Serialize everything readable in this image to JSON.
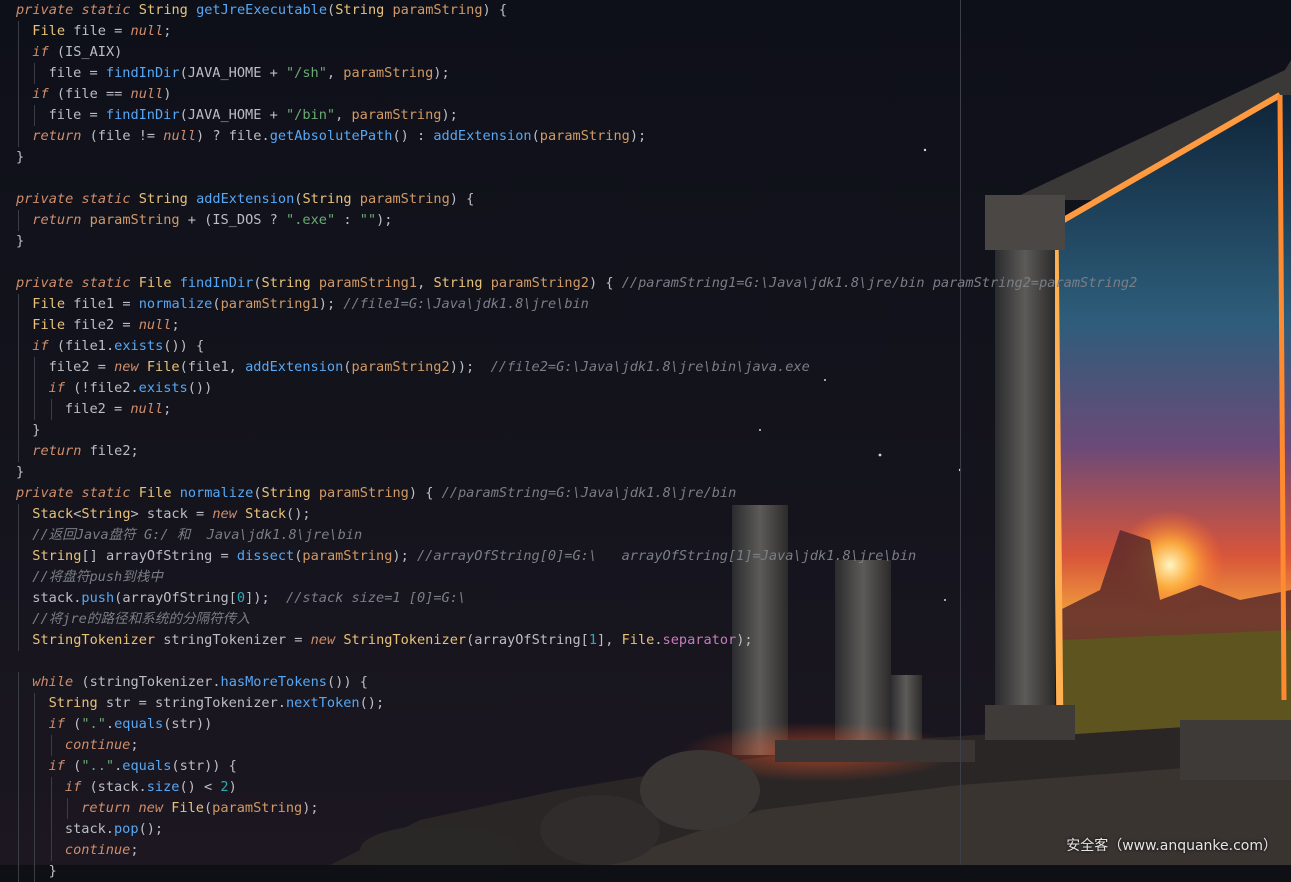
{
  "editor": {
    "colors": {
      "keyword": "#cf8e6d",
      "type": "#e8c27b",
      "method": "#56a8f5",
      "param": "#d19a66",
      "string": "#6aab73",
      "number": "#2aacb8",
      "comment": "#7a7e85",
      "const": "#c77dbb",
      "plain": "#bcbec4"
    },
    "lines": [
      {
        "indent": 0,
        "tokens": [
          [
            "private static ",
            "keyword"
          ],
          [
            "String ",
            "type"
          ],
          [
            "getJreExecutable",
            "method"
          ],
          [
            "(",
            "plain"
          ],
          [
            "String ",
            "type"
          ],
          [
            "paramString",
            "param"
          ],
          [
            ") {",
            "plain"
          ]
        ]
      },
      {
        "indent": 1,
        "tokens": [
          [
            "File",
            "type"
          ],
          [
            " file = ",
            "plain"
          ],
          [
            "null",
            "keyword"
          ],
          [
            ";",
            "plain"
          ]
        ]
      },
      {
        "indent": 1,
        "tokens": [
          [
            "if ",
            "keyword"
          ],
          [
            "(IS_AIX)",
            "plain"
          ]
        ]
      },
      {
        "indent": 2,
        "tokens": [
          [
            "file = ",
            "plain"
          ],
          [
            "findInDir",
            "method"
          ],
          [
            "(JAVA_HOME + ",
            "plain"
          ],
          [
            "\"/sh\"",
            "string"
          ],
          [
            ", ",
            "plain"
          ],
          [
            "paramString",
            "param"
          ],
          [
            ");",
            "plain"
          ]
        ]
      },
      {
        "indent": 1,
        "tokens": [
          [
            "if ",
            "keyword"
          ],
          [
            "(file == ",
            "plain"
          ],
          [
            "null",
            "keyword"
          ],
          [
            ")",
            "plain"
          ]
        ]
      },
      {
        "indent": 2,
        "tokens": [
          [
            "file = ",
            "plain"
          ],
          [
            "findInDir",
            "method"
          ],
          [
            "(JAVA_HOME + ",
            "plain"
          ],
          [
            "\"/bin\"",
            "string"
          ],
          [
            ", ",
            "plain"
          ],
          [
            "paramString",
            "param"
          ],
          [
            ");",
            "plain"
          ]
        ]
      },
      {
        "indent": 1,
        "tokens": [
          [
            "return ",
            "keyword"
          ],
          [
            "(file != ",
            "plain"
          ],
          [
            "null",
            "keyword"
          ],
          [
            ") ? file.",
            "plain"
          ],
          [
            "getAbsolutePath",
            "method"
          ],
          [
            "() : ",
            "plain"
          ],
          [
            "addExtension",
            "method"
          ],
          [
            "(",
            "plain"
          ],
          [
            "paramString",
            "param"
          ],
          [
            ");",
            "plain"
          ]
        ]
      },
      {
        "indent": 0,
        "tokens": [
          [
            "}",
            "plain"
          ]
        ]
      },
      {
        "indent": 0,
        "tokens": []
      },
      {
        "indent": 0,
        "tokens": [
          [
            "private static ",
            "keyword"
          ],
          [
            "String ",
            "type"
          ],
          [
            "addExtension",
            "method"
          ],
          [
            "(",
            "plain"
          ],
          [
            "String ",
            "type"
          ],
          [
            "paramString",
            "param"
          ],
          [
            ") {",
            "plain"
          ]
        ]
      },
      {
        "indent": 1,
        "tokens": [
          [
            "return ",
            "keyword"
          ],
          [
            "paramString",
            "param"
          ],
          [
            " + (IS_DOS ? ",
            "plain"
          ],
          [
            "\".exe\"",
            "string"
          ],
          [
            " : ",
            "plain"
          ],
          [
            "\"\"",
            "string"
          ],
          [
            ");",
            "plain"
          ]
        ]
      },
      {
        "indent": 0,
        "tokens": [
          [
            "}",
            "plain"
          ]
        ]
      },
      {
        "indent": 0,
        "tokens": []
      },
      {
        "indent": 0,
        "tokens": [
          [
            "private static ",
            "keyword"
          ],
          [
            "File ",
            "type"
          ],
          [
            "findInDir",
            "method"
          ],
          [
            "(",
            "plain"
          ],
          [
            "String ",
            "type"
          ],
          [
            "paramString1",
            "param"
          ],
          [
            ", ",
            "plain"
          ],
          [
            "String ",
            "type"
          ],
          [
            "paramString2",
            "param"
          ],
          [
            ") { ",
            "plain"
          ],
          [
            "//paramString1=G:\\Java\\jdk1.8\\jre/bin paramString2=paramString2",
            "comment"
          ]
        ]
      },
      {
        "indent": 1,
        "tokens": [
          [
            "File ",
            "type"
          ],
          [
            "file1 = ",
            "plain"
          ],
          [
            "normalize",
            "method"
          ],
          [
            "(",
            "plain"
          ],
          [
            "paramString1",
            "param"
          ],
          [
            "); ",
            "plain"
          ],
          [
            "//file1=G:\\Java\\jdk1.8\\jre\\bin",
            "comment"
          ]
        ]
      },
      {
        "indent": 1,
        "tokens": [
          [
            "File ",
            "type"
          ],
          [
            "file2 = ",
            "plain"
          ],
          [
            "null",
            "keyword"
          ],
          [
            ";",
            "plain"
          ]
        ]
      },
      {
        "indent": 1,
        "tokens": [
          [
            "if ",
            "keyword"
          ],
          [
            "(file1.",
            "plain"
          ],
          [
            "exists",
            "method"
          ],
          [
            "()) {",
            "plain"
          ]
        ]
      },
      {
        "indent": 2,
        "tokens": [
          [
            "file2 = ",
            "plain"
          ],
          [
            "new ",
            "keyword"
          ],
          [
            "File",
            "type"
          ],
          [
            "(file1, ",
            "plain"
          ],
          [
            "addExtension",
            "method"
          ],
          [
            "(",
            "plain"
          ],
          [
            "paramString2",
            "param"
          ],
          [
            "));  ",
            "plain"
          ],
          [
            "//file2=G:\\Java\\jdk1.8\\jre\\bin\\java.exe",
            "comment"
          ]
        ]
      },
      {
        "indent": 2,
        "tokens": [
          [
            "if ",
            "keyword"
          ],
          [
            "(!file2.",
            "plain"
          ],
          [
            "exists",
            "method"
          ],
          [
            "())",
            "plain"
          ]
        ]
      },
      {
        "indent": 3,
        "tokens": [
          [
            "file2 = ",
            "plain"
          ],
          [
            "null",
            "keyword"
          ],
          [
            ";",
            "plain"
          ]
        ]
      },
      {
        "indent": 1,
        "tokens": [
          [
            "}",
            "plain"
          ]
        ]
      },
      {
        "indent": 1,
        "tokens": [
          [
            "return ",
            "keyword"
          ],
          [
            "file2;",
            "plain"
          ]
        ]
      },
      {
        "indent": 0,
        "tokens": [
          [
            "}",
            "plain"
          ]
        ]
      },
      {
        "indent": 0,
        "tokens": [
          [
            "private static ",
            "keyword"
          ],
          [
            "File ",
            "type"
          ],
          [
            "normalize",
            "method"
          ],
          [
            "(",
            "plain"
          ],
          [
            "String ",
            "type"
          ],
          [
            "paramString",
            "param"
          ],
          [
            ") { ",
            "plain"
          ],
          [
            "//paramString=G:\\Java\\jdk1.8\\jre/bin",
            "comment"
          ]
        ]
      },
      {
        "indent": 1,
        "tokens": [
          [
            "Stack",
            "type"
          ],
          [
            "<",
            "plain"
          ],
          [
            "String",
            "type"
          ],
          [
            "> stack = ",
            "plain"
          ],
          [
            "new ",
            "keyword"
          ],
          [
            "Stack",
            "type"
          ],
          [
            "();",
            "plain"
          ]
        ]
      },
      {
        "indent": 1,
        "tokens": [
          [
            "//返回Java盘符 G:/ 和  Java\\jdk1.8\\jre\\bin",
            "comment"
          ]
        ]
      },
      {
        "indent": 1,
        "tokens": [
          [
            "String",
            "type"
          ],
          [
            "[] arrayOfString = ",
            "plain"
          ],
          [
            "dissect",
            "method"
          ],
          [
            "(",
            "plain"
          ],
          [
            "paramString",
            "param"
          ],
          [
            "); ",
            "plain"
          ],
          [
            "//arrayOfString[0]=G:\\   arrayOfString[1]=Java\\jdk1.8\\jre\\bin",
            "comment"
          ]
        ]
      },
      {
        "indent": 1,
        "tokens": [
          [
            "//将盘符push到栈中",
            "comment"
          ]
        ]
      },
      {
        "indent": 1,
        "tokens": [
          [
            "stack.",
            "plain"
          ],
          [
            "push",
            "method"
          ],
          [
            "(arrayOfString[",
            "plain"
          ],
          [
            "0",
            "number"
          ],
          [
            "]);  ",
            "plain"
          ],
          [
            "//stack size=1 [0]=G:\\",
            "comment"
          ]
        ]
      },
      {
        "indent": 1,
        "tokens": [
          [
            "//将jre的路径和系统的分隔符传入",
            "comment"
          ]
        ]
      },
      {
        "indent": 1,
        "tokens": [
          [
            "StringTokenizer ",
            "type"
          ],
          [
            "stringTokenizer = ",
            "plain"
          ],
          [
            "new ",
            "keyword"
          ],
          [
            "StringTokenizer",
            "type"
          ],
          [
            "(arrayOfString[",
            "plain"
          ],
          [
            "1",
            "number"
          ],
          [
            "], ",
            "plain"
          ],
          [
            "File",
            "type"
          ],
          [
            ".",
            "plain"
          ],
          [
            "separator",
            "const"
          ],
          [
            ");",
            "plain"
          ]
        ]
      },
      {
        "indent": 0,
        "tokens": []
      },
      {
        "indent": 1,
        "tokens": [
          [
            "while ",
            "keyword"
          ],
          [
            "(stringTokenizer.",
            "plain"
          ],
          [
            "hasMoreTokens",
            "method"
          ],
          [
            "()) {",
            "plain"
          ]
        ]
      },
      {
        "indent": 2,
        "tokens": [
          [
            "String ",
            "type"
          ],
          [
            "str = stringTokenizer.",
            "plain"
          ],
          [
            "nextToken",
            "method"
          ],
          [
            "();",
            "plain"
          ]
        ]
      },
      {
        "indent": 2,
        "tokens": [
          [
            "if ",
            "keyword"
          ],
          [
            "(",
            "plain"
          ],
          [
            "\".\"",
            "string"
          ],
          [
            ".",
            "plain"
          ],
          [
            "equals",
            "method"
          ],
          [
            "(str))",
            "plain"
          ]
        ]
      },
      {
        "indent": 3,
        "tokens": [
          [
            "continue",
            "keyword"
          ],
          [
            ";",
            "plain"
          ]
        ]
      },
      {
        "indent": 2,
        "tokens": [
          [
            "if ",
            "keyword"
          ],
          [
            "(",
            "plain"
          ],
          [
            "\"..\"",
            "string"
          ],
          [
            ".",
            "plain"
          ],
          [
            "equals",
            "method"
          ],
          [
            "(str)) {",
            "plain"
          ]
        ]
      },
      {
        "indent": 3,
        "tokens": [
          [
            "if ",
            "keyword"
          ],
          [
            "(stack.",
            "plain"
          ],
          [
            "size",
            "method"
          ],
          [
            "() < ",
            "plain"
          ],
          [
            "2",
            "number"
          ],
          [
            ")",
            "plain"
          ]
        ]
      },
      {
        "indent": 4,
        "tokens": [
          [
            "return new ",
            "keyword"
          ],
          [
            "File",
            "type"
          ],
          [
            "(",
            "plain"
          ],
          [
            "paramString",
            "param"
          ],
          [
            ");",
            "plain"
          ]
        ]
      },
      {
        "indent": 3,
        "tokens": [
          [
            "stack.",
            "plain"
          ],
          [
            "pop",
            "method"
          ],
          [
            "();",
            "plain"
          ]
        ]
      },
      {
        "indent": 3,
        "tokens": [
          [
            "continue",
            "keyword"
          ],
          [
            ";",
            "plain"
          ]
        ]
      },
      {
        "indent": 2,
        "tokens": [
          [
            "}",
            "plain"
          ]
        ]
      }
    ]
  },
  "watermark": {
    "text": "安全客（www.anquanke.com）"
  }
}
